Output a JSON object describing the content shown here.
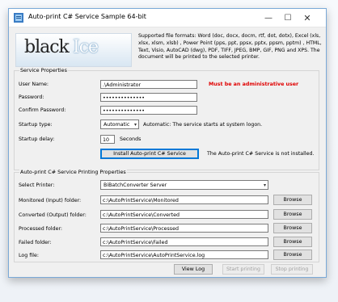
{
  "window": {
    "title": "Auto-print C# Service Sample 64-bit",
    "controls": {
      "minimize": "—",
      "maximize": "☐",
      "close": "✕"
    }
  },
  "logo": {
    "part1": "black",
    "part2": "Ice"
  },
  "supported_formats": "Supported file formats: Word (doc, docx, docm, rtf, dot, dotx), Excel (xls, xlsx, xlsm, xlsb) , Power Point (pps, ppt, ppsx, pptx, ppsm, pptm) , HTML, Text, Visio, AutoCAD (dwg), PDF,  TIFF, JPEG, BMP, GIF, PNG and XPS. The document will be printed to the selected printer.",
  "service_properties": {
    "title": "Service Properties",
    "user_name_label": "User Name:",
    "user_name_value": ".\\Administrator",
    "admin_warning": "Must be an administrative user",
    "password_label": "Password:",
    "password_value": "••••••••••••••",
    "confirm_password_label": "Confirm Password:",
    "confirm_password_value": "••••••••••••••",
    "startup_type_label": "Startup type:",
    "startup_type_value": "Automatic",
    "startup_type_desc": "Automatic: The service starts at system logon.",
    "startup_delay_label": "Startup delay:",
    "startup_delay_value": "10",
    "startup_delay_unit": "Seconds",
    "install_button": "Install Auto-print C# Service",
    "install_status": "The Auto-print C# Service is not installed."
  },
  "printing_properties": {
    "title": "Auto-print C# Service Printing Properties",
    "printer_label": "Select Printer:",
    "printer_value": "BiBatchConverter Server",
    "monitored_label": "Monitored (Input) folder:",
    "monitored_value": "c:\\AutoPrintService\\Monitored",
    "converted_label": "Converted (Output) folder:",
    "converted_value": "c:\\AutoPrintService\\Converted",
    "processed_label": "Processed folder:",
    "processed_value": "c:\\AutoPrintService\\Processed",
    "failed_label": "Failed folder:",
    "failed_value": "c:\\AutoPrintService\\Failed",
    "log_label": "Log file:",
    "log_value": "c:\\AutoPrintService\\AutoPrintService.log",
    "browse_label": "Browse"
  },
  "footer": {
    "view_log": "View Log",
    "start_printing": "Start printing",
    "stop_printing": "Stop printing"
  }
}
